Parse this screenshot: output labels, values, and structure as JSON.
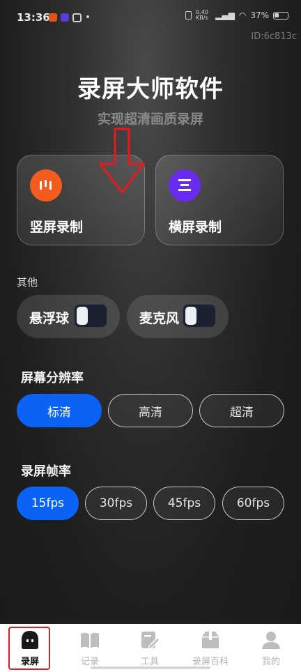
{
  "status_bar": {
    "time": "13:36",
    "network_speed": "0.40 KB/s",
    "battery": "37%"
  },
  "id_label": "ID:6c813c",
  "header": {
    "title": "录屏大师软件",
    "subtitle": "实现超清画质录屏"
  },
  "record_modes": {
    "portrait_label": "竖屏录制",
    "landscape_label": "横屏录制",
    "portrait_color": "#f25c1e",
    "landscape_color": "#6a2bf0"
  },
  "others": {
    "section_label": "其他",
    "floating_ball_label": "悬浮球",
    "floating_ball_on": false,
    "microphone_label": "麦克风",
    "microphone_on": false
  },
  "resolution": {
    "title": "屏幕分辨率",
    "options": [
      "标清",
      "高清",
      "超清"
    ],
    "selected": "标清"
  },
  "framerate": {
    "title": "录屏帧率",
    "options": [
      "15fps",
      "30fps",
      "45fps",
      "60fps"
    ],
    "selected": "15fps"
  },
  "bottom_nav": {
    "items": [
      {
        "label": "录屏",
        "icon": "record-screen-icon",
        "active": true
      },
      {
        "label": "记录",
        "icon": "book-icon",
        "active": false
      },
      {
        "label": "工具",
        "icon": "edit-tool-icon",
        "active": false
      },
      {
        "label": "录屏百科",
        "icon": "box-icon",
        "active": false
      },
      {
        "label": "我的",
        "icon": "person-icon",
        "active": false
      }
    ]
  },
  "colors": {
    "accent": "#0a63f5",
    "highlight": "#e5191e"
  }
}
